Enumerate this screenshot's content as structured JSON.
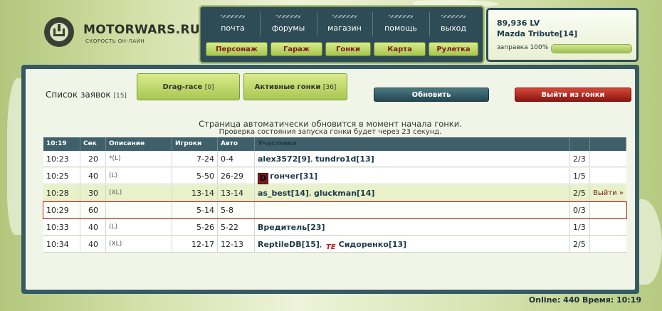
{
  "logo": {
    "name": "MOTORWARS.RU",
    "tagline": "СКОРОСТЬ ОН-ЛАЙН"
  },
  "top_links": [
    {
      "label": "почта"
    },
    {
      "label": "форумы"
    },
    {
      "label": "магазин"
    },
    {
      "label": "помощь"
    },
    {
      "label": "выход"
    }
  ],
  "nav_buttons": [
    {
      "label": "Персонаж"
    },
    {
      "label": "Гараж"
    },
    {
      "label": "Гонки"
    },
    {
      "label": "Карта"
    },
    {
      "label": "Рулетка"
    }
  ],
  "player": {
    "money": "89,936 LV",
    "car": "Mazda Tribute[14]",
    "fuel_label": "заправка 100%",
    "fuel_level": 1.0
  },
  "race_list": {
    "title": "Список заявок",
    "count": "[15]"
  },
  "tabs": [
    {
      "label": "Drag-race",
      "count": "[0]"
    },
    {
      "label": "Активные гонки",
      "count": "[36]"
    }
  ],
  "buttons": {
    "refresh": "Обновить",
    "leave": "Выйти из гонки"
  },
  "notices": {
    "line1": "Страница автоматически обновится в момент начала гонки.",
    "line2": "Проверка состояния запуска гонки будет через 23 секунд."
  },
  "table": {
    "headers": {
      "time": "10:19",
      "sec": "Сек",
      "desc": "Описание",
      "players": "Игроки",
      "cars": "Авто",
      "participants": "Участники"
    },
    "rows": [
      {
        "time": "10:23",
        "sec": "20",
        "desc": "*(L)",
        "players": "7-24",
        "cars": "0-4",
        "p1": "alex3572",
        "p1l": "[9]",
        "sep": ", ",
        "p2": "tundro1d",
        "p2l": "[13]",
        "badge2": "",
        "slots": "2/3",
        "action": ""
      },
      {
        "time": "10:25",
        "sec": "40",
        "desc": "(L)",
        "players": "5-50",
        "cars": "26-29",
        "badge1": "D",
        "p1": "гончег",
        "p1l": "[31]",
        "slots": "1/5",
        "action": ""
      },
      {
        "time": "10:28",
        "sec": "30",
        "desc": "(XL)",
        "players": "13-14",
        "cars": "13-14",
        "p1": "as_best",
        "p1l": "[14]",
        "sep": ", ",
        "p2": "gluckman",
        "p2l": "[14]",
        "slots": "2/5",
        "action": "Выйти »"
      },
      {
        "time": "10:29",
        "sec": "60",
        "desc": "",
        "players": "5-14",
        "cars": "5-8",
        "slots": "0/3",
        "action": ""
      },
      {
        "time": "10:33",
        "sec": "40",
        "desc": "(L)",
        "players": "5-26",
        "cars": "5-22",
        "p1": "Вредитель",
        "p1l": "[23]",
        "slots": "1/3",
        "action": ""
      },
      {
        "time": "10:34",
        "sec": "40",
        "desc": "(XL)",
        "players": "12-17",
        "cars": "12-13",
        "p1": "ReptileDB",
        "p1l": "[15]",
        "sep": ", ",
        "badge2": "TE",
        "p2": "Сидоренко",
        "p2l": "[13]",
        "slots": "2/5",
        "action": ""
      }
    ]
  },
  "footer": {
    "online": "Online: 440",
    "time": "Время: 10:19"
  }
}
